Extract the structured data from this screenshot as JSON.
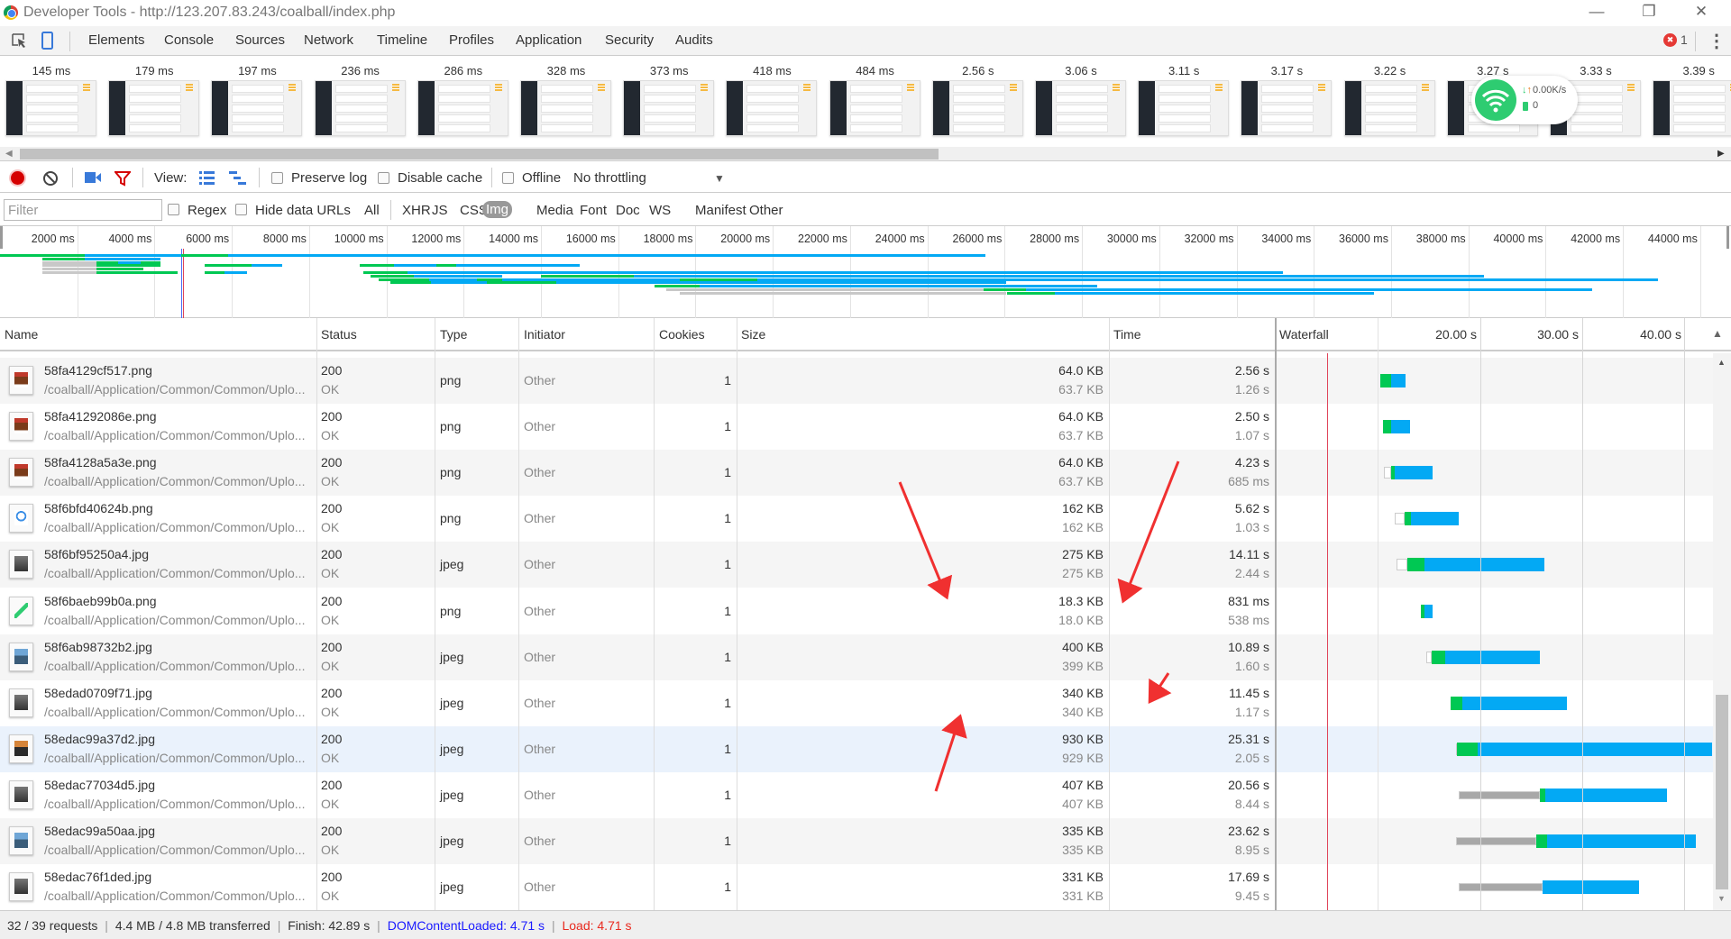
{
  "window": {
    "title": "Developer Tools - http://123.207.83.243/coalball/index.php",
    "minimize": "—",
    "restore": "❐",
    "close": "✕"
  },
  "tabs": [
    "Elements",
    "Console",
    "Sources",
    "Network",
    "Timeline",
    "Profiles",
    "Application",
    "Security",
    "Audits"
  ],
  "active_tab": "Network",
  "error_count": "1",
  "error_icon": "✖",
  "more_icon": "⋮",
  "filmstrip": [
    "145 ms",
    "179 ms",
    "197 ms",
    "236 ms",
    "286 ms",
    "328 ms",
    "373 ms",
    "418 ms",
    "484 ms",
    "2.56 s",
    "3.06 s",
    "3.11 s",
    "3.17 s",
    "3.22 s",
    "3.27 s",
    "3.33 s",
    "3.39 s"
  ],
  "wifi_widget": {
    "speed": "0.00K/s",
    "count": "0",
    "color": "#2ecc71"
  },
  "toolbar": {
    "view_label": "View:",
    "preserve_log": "Preserve log",
    "disable_cache": "Disable cache",
    "offline": "Offline",
    "throttling": "No throttling",
    "dropdown_arrow": "▼"
  },
  "filter": {
    "placeholder": "Filter",
    "regex": "Regex",
    "hide_data_urls": "Hide data URLs",
    "types": [
      "All",
      "XHR",
      "JS",
      "CSS",
      "Img",
      "Media",
      "Font",
      "Doc",
      "WS",
      "Manifest",
      "Other"
    ],
    "selected": "Img"
  },
  "overview": {
    "ticks": [
      "2000 ms",
      "4000 ms",
      "6000 ms",
      "8000 ms",
      "10000 ms",
      "12000 ms",
      "14000 ms",
      "16000 ms",
      "18000 ms",
      "20000 ms",
      "22000 ms",
      "24000 ms",
      "26000 ms",
      "28000 ms",
      "30000 ms",
      "32000 ms",
      "34000 ms",
      "36000 ms",
      "38000 ms",
      "40000 ms",
      "42000 ms",
      "44000 ms"
    ],
    "dom_content_loaded_ms": 4710,
    "load_ms": 4710,
    "rows": [
      [
        [
          "g",
          0,
          2200
        ],
        [
          "b",
          2200,
          25500
        ],
        [
          "g",
          4700,
          5900
        ]
      ],
      [
        [
          "g",
          1100,
          2200
        ],
        [
          "b",
          2200,
          4150
        ]
      ],
      [
        [
          "q",
          1100,
          2500
        ],
        [
          "g",
          2500,
          3050
        ],
        [
          "b",
          3050,
          3650
        ],
        [
          "g",
          3650,
          4150
        ]
      ],
      [
        [
          "q",
          1100,
          2500
        ],
        [
          "g",
          2500,
          4150
        ],
        [
          "g",
          5300,
          6500
        ],
        [
          "b",
          6500,
          7300
        ],
        [
          "g",
          9300,
          10200
        ],
        [
          "b",
          10200,
          11300
        ],
        [
          "g",
          11300,
          11800
        ],
        [
          "b",
          11800,
          15000
        ]
      ],
      [
        [
          "q",
          1100,
          2500
        ],
        [
          "g",
          2500,
          3700
        ]
      ],
      [
        [
          "q",
          1100,
          2500
        ],
        [
          "g",
          2500,
          4600
        ],
        [
          "g",
          5300,
          5800
        ],
        [
          "b",
          5800,
          6400
        ],
        [
          "g",
          9400,
          10550
        ],
        [
          "b",
          10550,
          33200
        ]
      ],
      [
        [
          "g",
          9600,
          10700
        ],
        [
          "b",
          10700,
          13000
        ],
        [
          "g",
          14000,
          16400
        ],
        [
          "b",
          16400,
          38400
        ]
      ],
      [
        [
          "g",
          9800,
          11100
        ],
        [
          "b",
          11100,
          12350
        ],
        [
          "g",
          12350,
          13000
        ],
        [
          "b",
          13000,
          17600
        ],
        [
          "g",
          17600,
          19600
        ],
        [
          "b",
          19600,
          42900
        ]
      ],
      [
        [
          "g",
          10100,
          11150
        ],
        [
          "b",
          11150,
          12600
        ],
        [
          "g",
          12600,
          14400
        ],
        [
          "b",
          14400,
          26050
        ]
      ],
      [
        [
          "g",
          16950,
          18100
        ],
        [
          "b",
          18100,
          28400
        ]
      ],
      [
        [
          "q",
          17250,
          25450
        ],
        [
          "g",
          25450,
          26550
        ],
        [
          "b",
          26550,
          41200
        ]
      ],
      [
        [
          "q",
          17600,
          26050
        ],
        [
          "g",
          26050,
          27300
        ],
        [
          "b",
          27300,
          35550
        ]
      ]
    ]
  },
  "table": {
    "headers": {
      "name": "Name",
      "status": "Status",
      "type": "Type",
      "initiator": "Initiator",
      "cookies": "Cookies",
      "size": "Size",
      "time": "Time",
      "waterfall": "Waterfall",
      "sort_icon": "▲"
    },
    "waterfall_ticks": [
      "20.00 s",
      "30.00 s",
      "40.00 s"
    ],
    "rows": [
      {
        "name": "58fa4129cf517.png",
        "path": "/coalball/Application/Common/Common/Uplo...",
        "status": "200",
        "status_text": "OK",
        "type": "png",
        "initiator": "Other",
        "cookies": "1",
        "size": "64.0 KB",
        "size_res": "63.7 KB",
        "time": "2.56 s",
        "latency": "1.26 s",
        "icon": "avatar-thumbnail-icon",
        "wf": [
          10.2,
          10.2,
          11.3,
          12.7
        ]
      },
      {
        "name": "58fa41292086e.png",
        "path": "/coalball/Application/Common/Common/Uplo...",
        "status": "200",
        "status_text": "OK",
        "type": "png",
        "initiator": "Other",
        "cookies": "1",
        "size": "64.0 KB",
        "size_res": "63.7 KB",
        "time": "2.50 s",
        "latency": "1.07 s",
        "icon": "avatar-thumbnail-icon",
        "wf": [
          10.5,
          10.5,
          11.3,
          13.1
        ]
      },
      {
        "name": "58fa4128a5a3e.png",
        "path": "/coalball/Application/Common/Common/Uplo...",
        "status": "200",
        "status_text": "OK",
        "type": "png",
        "initiator": "Other",
        "cookies": "1",
        "size": "64.0 KB",
        "size_res": "63.7 KB",
        "time": "4.23 s",
        "latency": "685 ms",
        "icon": "avatar-thumbnail-icon",
        "wf": [
          10.6,
          11.3,
          11.6,
          15.3
        ]
      },
      {
        "name": "58f6bfd40624b.png",
        "path": "/coalball/Application/Common/Common/Uplo...",
        "status": "200",
        "status_text": "OK",
        "type": "png",
        "initiator": "Other",
        "cookies": "1",
        "size": "162 KB",
        "size_res": "162 KB",
        "time": "5.62 s",
        "latency": "1.03 s",
        "icon": "cartoon-thumbnail-icon",
        "wf": [
          11.6,
          12.6,
          13.2,
          17.9
        ]
      },
      {
        "name": "58f6bf95250a4.jpg",
        "path": "/coalball/Application/Common/Common/Uplo...",
        "status": "200",
        "status_text": "OK",
        "type": "jpeg",
        "initiator": "Other",
        "cookies": "1",
        "size": "275 KB",
        "size_res": "275 KB",
        "time": "14.11 s",
        "latency": "2.44 s",
        "icon": "photo-thumbnail-icon",
        "wf": [
          11.8,
          12.9,
          14.5,
          26.3
        ]
      },
      {
        "name": "58f6baeb99b0a.png",
        "path": "/coalball/Application/Common/Common/Uplo...",
        "status": "200",
        "status_text": "OK",
        "type": "png",
        "initiator": "Other",
        "cookies": "1",
        "size": "18.3 KB",
        "size_res": "18.0 KB",
        "time": "831 ms",
        "latency": "538 ms",
        "icon": "checkmark-thumbnail-icon",
        "wf": [
          14.2,
          14.2,
          14.5,
          15.3
        ]
      },
      {
        "name": "58f6ab98732b2.jpg",
        "path": "/coalball/Application/Common/Common/Uplo...",
        "status": "200",
        "status_text": "OK",
        "type": "jpeg",
        "initiator": "Other",
        "cookies": "1",
        "size": "400 KB",
        "size_res": "399 KB",
        "time": "10.89 s",
        "latency": "1.60 s",
        "icon": "landscape-thumbnail-icon",
        "wf": [
          14.7,
          15.2,
          16.6,
          25.8
        ]
      },
      {
        "name": "58edad0709f71.jpg",
        "path": "/coalball/Application/Common/Common/Uplo...",
        "status": "200",
        "status_text": "OK",
        "type": "jpeg",
        "initiator": "Other",
        "cookies": "1",
        "size": "340 KB",
        "size_res": "340 KB",
        "time": "11.45 s",
        "latency": "1.17 s",
        "icon": "photo-thumbnail-icon",
        "wf": [
          17.1,
          17.1,
          18.2,
          28.5
        ]
      },
      {
        "name": "58edac99a37d2.jpg",
        "path": "/coalball/Application/Common/Common/Uplo...",
        "status": "200",
        "status_text": "OK",
        "type": "jpeg",
        "initiator": "Other",
        "cookies": "1",
        "size": "930 KB",
        "size_res": "929 KB",
        "time": "25.31 s",
        "latency": "2.05 s",
        "icon": "sunset-thumbnail-icon",
        "wf": [
          17.6,
          17.7,
          19.7,
          42.6
        ],
        "selected": true
      },
      {
        "name": "58edac77034d5.jpg",
        "path": "/coalball/Application/Common/Common/Uplo...",
        "status": "200",
        "status_text": "OK",
        "type": "jpeg",
        "initiator": "Other",
        "cookies": "1",
        "size": "407 KB",
        "size_res": "407 KB",
        "time": "20.56 s",
        "latency": "8.44 s",
        "icon": "photo-thumbnail-icon",
        "wf": [
          17.9,
          25.8,
          26.3,
          38.2
        ]
      },
      {
        "name": "58edac99a50aa.jpg",
        "path": "/coalball/Application/Common/Common/Uplo...",
        "status": "200",
        "status_text": "OK",
        "type": "jpeg",
        "initiator": "Other",
        "cookies": "1",
        "size": "335 KB",
        "size_res": "335 KB",
        "time": "23.62 s",
        "latency": "8.95 s",
        "icon": "landscape-thumbnail-icon",
        "wf": [
          17.6,
          25.5,
          26.5,
          41.1
        ]
      },
      {
        "name": "58edac76f1ded.jpg",
        "path": "/coalball/Application/Common/Common/Uplo...",
        "status": "200",
        "status_text": "OK",
        "type": "jpeg",
        "initiator": "Other",
        "cookies": "1",
        "size": "331 KB",
        "size_res": "331 KB",
        "time": "17.69 s",
        "latency": "9.45 s",
        "icon": "photo-thumbnail-icon",
        "wf": [
          17.9,
          26.1,
          26.1,
          35.5
        ]
      }
    ]
  },
  "status_bar": {
    "requests": "32 / 39 requests",
    "transferred": "4.4 MB / 4.8 MB transferred",
    "finish": "Finish: 42.89 s",
    "dcl": "DOMContentLoaded: 4.71 s",
    "load": "Load: 4.71 s",
    "sep": "|"
  },
  "colors": {
    "accent": "#3879d9",
    "waiting": "#00c853",
    "download": "#03a9f4",
    "queued": "#a8a8a8",
    "load_line": "#e0455a",
    "dcl_color": "#1a1aff",
    "load_color": "#e8291e",
    "record": "#d50000",
    "selected_row": "#eaf2fc"
  }
}
